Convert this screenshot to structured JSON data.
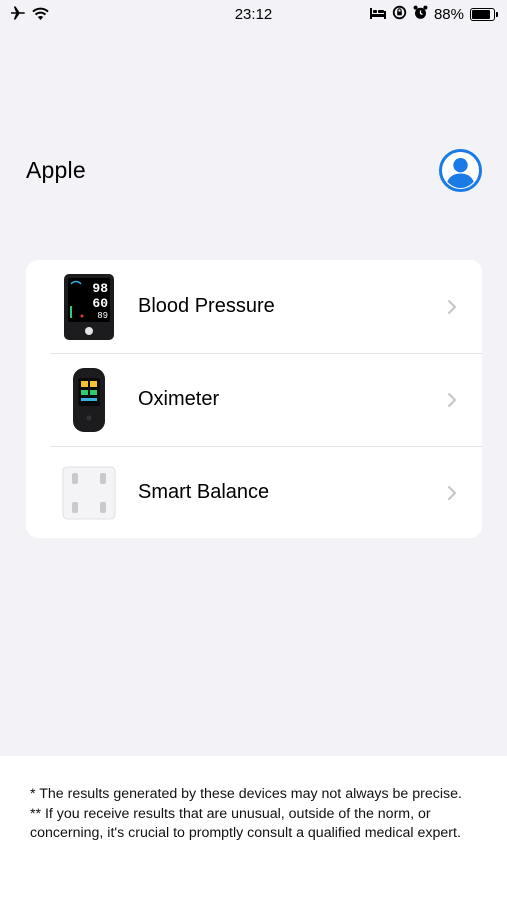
{
  "status_bar": {
    "time": "23:12",
    "battery_text": "88%",
    "battery_level": 0.88,
    "icons": [
      "airplane-icon",
      "wifi-icon",
      "bed-icon",
      "rotation-lock-icon",
      "alarm-icon",
      "battery-icon"
    ]
  },
  "header": {
    "title": "Apple",
    "profile_icon": "person-circle-icon",
    "accent_color": "#1a7ae6"
  },
  "devices": [
    {
      "label": "Blood Pressure",
      "icon": "blood-pressure-monitor-icon",
      "readings": [
        "98",
        "60",
        "89"
      ]
    },
    {
      "label": "Oximeter",
      "icon": "oximeter-icon"
    },
    {
      "label": "Smart Balance",
      "icon": "smart-scale-icon"
    }
  ],
  "footer": {
    "note_1": "*  The results generated by these devices may not always be precise.",
    "note_2": "** If you receive results that are unusual, outside of the norm, or concerning, it's crucial to promptly consult a qualified medical expert."
  }
}
